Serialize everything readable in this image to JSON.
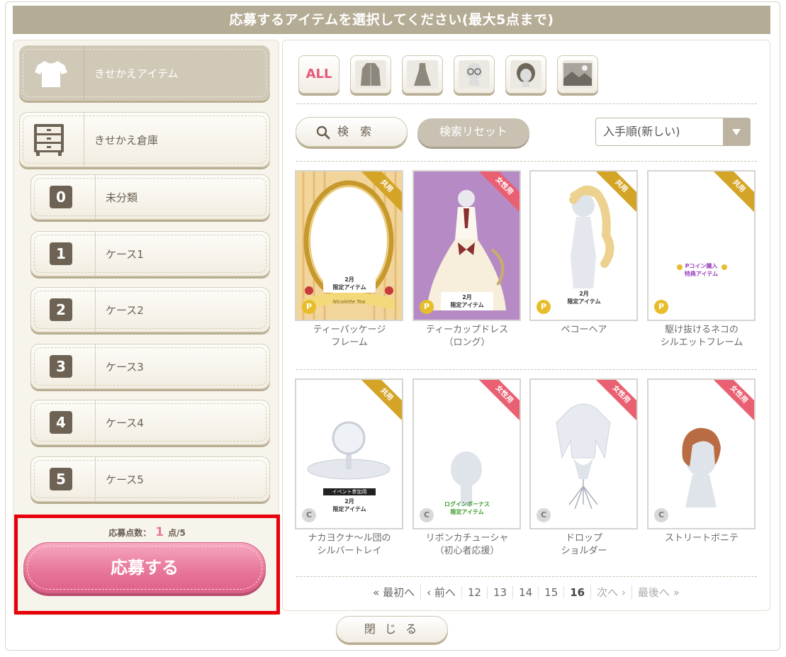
{
  "header": {
    "title": "応募するアイテムを選択してください(最大5点まで)"
  },
  "sidebar": {
    "main_items": [
      {
        "label": "きせかえアイテム",
        "icon": "tshirt-icon",
        "active": true
      },
      {
        "label": "きせかえ倉庫",
        "icon": "dresser-icon",
        "active": false
      }
    ],
    "cases": [
      {
        "num": "0",
        "label": "未分類"
      },
      {
        "num": "1",
        "label": "ケース1"
      },
      {
        "num": "2",
        "label": "ケース2"
      },
      {
        "num": "3",
        "label": "ケース3"
      },
      {
        "num": "4",
        "label": "ケース4"
      },
      {
        "num": "5",
        "label": "ケース5"
      }
    ]
  },
  "apply": {
    "count_label": "応募点数：",
    "count": "1",
    "count_suffix": "点/5",
    "button_label": "応募する"
  },
  "filters": [
    {
      "label": "ALL",
      "icon": "all-icon"
    },
    {
      "label": "",
      "icon": "coat-icon"
    },
    {
      "label": "",
      "icon": "dress-icon"
    },
    {
      "label": "",
      "icon": "face-accessory-icon"
    },
    {
      "label": "",
      "icon": "hair-icon"
    },
    {
      "label": "",
      "icon": "background-icon"
    }
  ],
  "search": {
    "search_label": "検　索",
    "reset_label": "検索リセット",
    "sort_selected": "入手順(新しい)"
  },
  "items": [
    {
      "name_line1": "ティーパッケージ",
      "name_line2": "フレーム",
      "badge": "共用",
      "coin": "P"
    },
    {
      "name_line1": "ティーカップドレス",
      "name_line2": "（ロング）",
      "badge": "女性用",
      "coin": "P"
    },
    {
      "name_line1": "ペコーヘア",
      "name_line2": "",
      "badge": "共用",
      "coin": "P"
    },
    {
      "name_line1": "駆け抜けるネコの",
      "name_line2": "シルエットフレーム",
      "badge": "共用",
      "coin": "P"
    },
    {
      "name_line1": "ナカヨクナ〜ル団の",
      "name_line2": "シルバートレイ",
      "badge": "共用",
      "coin": "C"
    },
    {
      "name_line1": "リボンカチューシャ",
      "name_line2": "（初心者応援）",
      "badge": "女性用",
      "coin": "C"
    },
    {
      "name_line1": "ドロップ",
      "name_line2": "ショルダー",
      "badge": "女性用",
      "coin": "C"
    },
    {
      "name_line1": "ストリートボニテ",
      "name_line2": "",
      "badge": "女性用",
      "coin": "C"
    }
  ],
  "item_stickers": {
    "month_limited": "2月\n限定アイテム",
    "pcoin_bonus": "Pコイン購入\n特典アイテム",
    "event_use": "イベント参加用",
    "login_bonus": "ログインボーナス\n限定アイテム",
    "frame_signature": "Nicolette Tea"
  },
  "pagination": {
    "first": "« 最初へ",
    "prev": "‹ 前へ",
    "pages": [
      "12",
      "13",
      "14",
      "15",
      "16"
    ],
    "current": "16",
    "next": "次へ ›",
    "last": "最後へ »"
  },
  "footer": {
    "close_label": "閉 じ る"
  },
  "colors": {
    "header_bg": "#b5ac95",
    "apply_pink": "#e8789a",
    "highlight_red": "#e8000b",
    "shared_badge": "#d3a425",
    "female_badge": "#e96072"
  }
}
